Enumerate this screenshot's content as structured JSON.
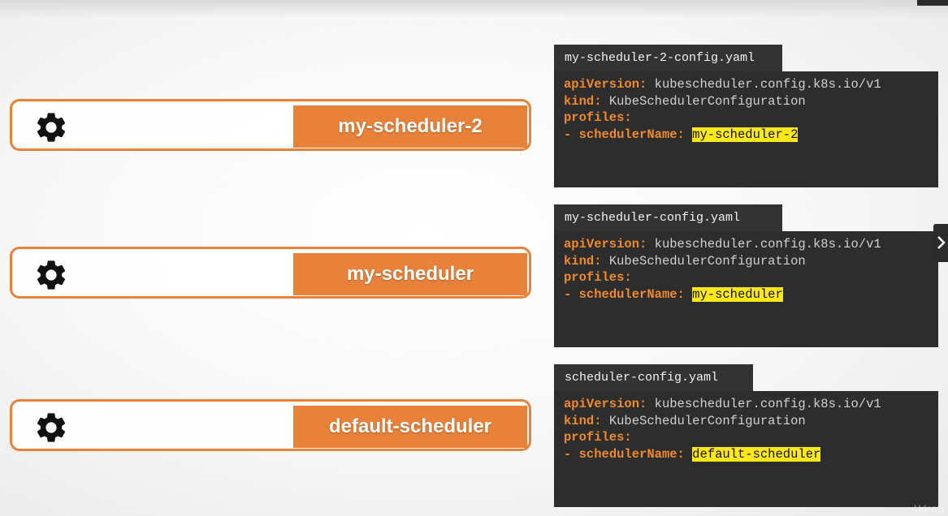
{
  "schedulers": [
    {
      "label": "my-scheduler-2",
      "icon": "gear-icon"
    },
    {
      "label": "my-scheduler",
      "icon": "gear-icon"
    },
    {
      "label": "default-scheduler",
      "icon": "gear-icon"
    }
  ],
  "configs": [
    {
      "filename": "my-scheduler-2-config.yaml",
      "lines": {
        "api_key": "apiVersion:",
        "api_val": "kubescheduler.config.k8s.io/v1",
        "kind_key": "kind:",
        "kind_val": "KubeSchedulerConfiguration",
        "profiles_key": "profiles:",
        "dash": "-",
        "name_key": "schedulerName:",
        "name_val": "my-scheduler-2"
      }
    },
    {
      "filename": "my-scheduler-config.yaml",
      "lines": {
        "api_key": "apiVersion:",
        "api_val": "kubescheduler.config.k8s.io/v1",
        "kind_key": "kind:",
        "kind_val": "KubeSchedulerConfiguration",
        "profiles_key": "profiles:",
        "dash": "-",
        "name_key": "schedulerName:",
        "name_val": "my-scheduler"
      }
    },
    {
      "filename": "scheduler-config.yaml",
      "lines": {
        "api_key": "apiVersion:",
        "api_val": "kubescheduler.config.k8s.io/v1",
        "kind_key": "kind:",
        "kind_val": "KubeSchedulerConfiguration",
        "profiles_key": "profiles:",
        "dash": "-",
        "name_key": "schedulerName:",
        "name_val": "default-scheduler"
      }
    }
  ],
  "watermark": "Udemy",
  "colors": {
    "accent": "#e8823a",
    "code_bg": "#2d2d2d",
    "yaml_key": "#f08a2a",
    "highlight": "#ffe81a"
  },
  "icons": {
    "next": "chevron-right-icon"
  }
}
